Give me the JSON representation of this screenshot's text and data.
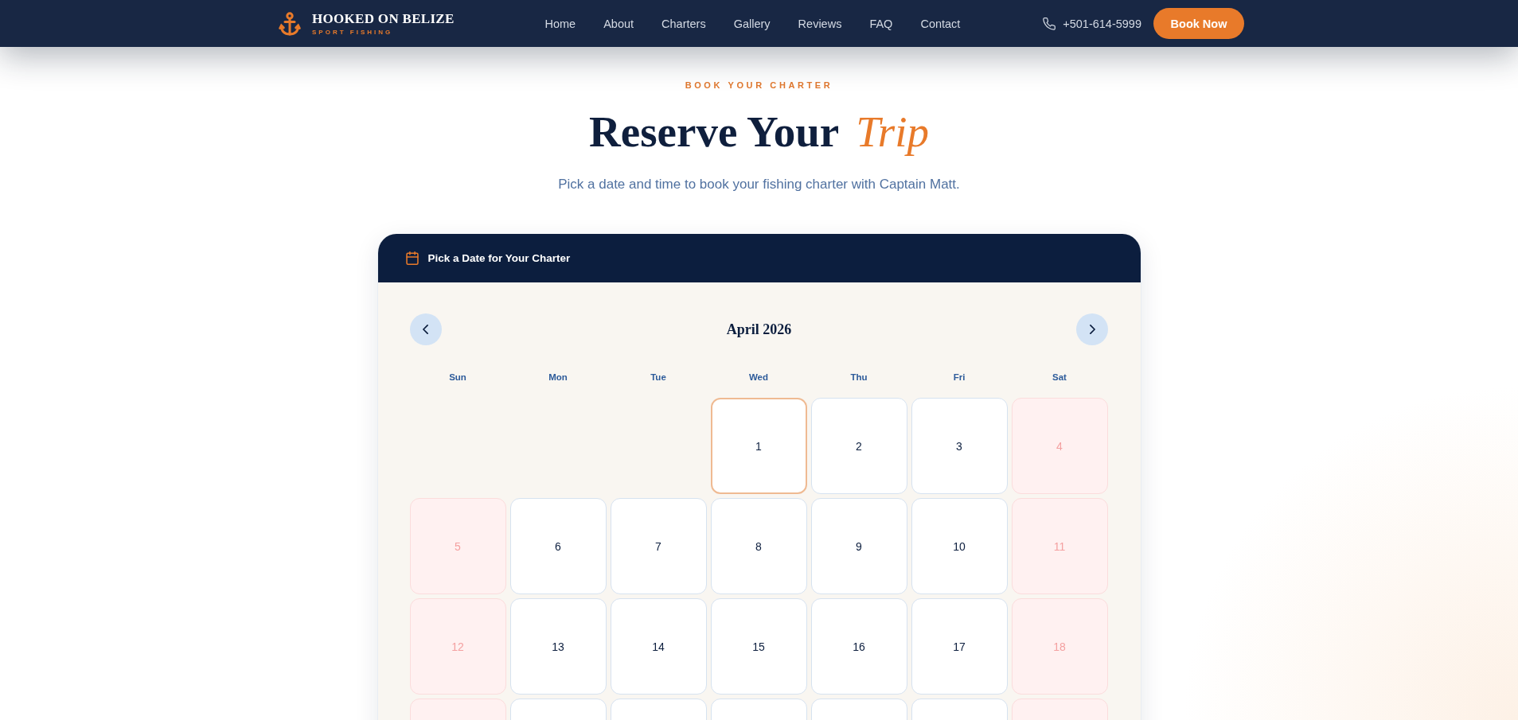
{
  "header": {
    "logo": {
      "title": "HOOKED ON BELIZE",
      "tagline": "SPORT FISHING"
    },
    "nav": [
      "Home",
      "About",
      "Charters",
      "Gallery",
      "Reviews",
      "FAQ",
      "Contact"
    ],
    "phone": "+501-614-5999",
    "cta": "Book Now"
  },
  "intro": {
    "eyebrow": "BOOK YOUR CHARTER",
    "heading": "Reserve Your *Trip*",
    "subtitle": "Pick a date and time to book your fishing charter with Captain Matt."
  },
  "calendar": {
    "title": "Pick a Date for Your Charter",
    "month": "April 2026",
    "weekdays": [
      "Sun",
      "Mon",
      "Tue",
      "Wed",
      "Thu",
      "Fri",
      "Sat"
    ],
    "weeks": [
      [
        {
          "kind": "empty"
        },
        {
          "kind": "empty"
        },
        {
          "kind": "empty"
        },
        {
          "kind": "day",
          "day": "1",
          "selected": true,
          "disabled": false
        },
        {
          "kind": "day",
          "day": "2",
          "selected": false,
          "disabled": false
        },
        {
          "kind": "day",
          "day": "3",
          "selected": false,
          "disabled": false
        },
        {
          "kind": "day",
          "day": "4",
          "selected": false,
          "disabled": true
        }
      ],
      [
        {
          "kind": "day",
          "day": "5",
          "selected": false,
          "disabled": true
        },
        {
          "kind": "day",
          "day": "6",
          "selected": false,
          "disabled": false
        },
        {
          "kind": "day",
          "day": "7",
          "selected": false,
          "disabled": false
        },
        {
          "kind": "day",
          "day": "8",
          "selected": false,
          "disabled": false
        },
        {
          "kind": "day",
          "day": "9",
          "selected": false,
          "disabled": false
        },
        {
          "kind": "day",
          "day": "10",
          "selected": false,
          "disabled": false
        },
        {
          "kind": "day",
          "day": "11",
          "selected": false,
          "disabled": true
        }
      ],
      [
        {
          "kind": "day",
          "day": "12",
          "selected": false,
          "disabled": true
        },
        {
          "kind": "day",
          "day": "13",
          "selected": false,
          "disabled": false
        },
        {
          "kind": "day",
          "day": "14",
          "selected": false,
          "disabled": false
        },
        {
          "kind": "day",
          "day": "15",
          "selected": false,
          "disabled": false
        },
        {
          "kind": "day",
          "day": "16",
          "selected": false,
          "disabled": false
        },
        {
          "kind": "day",
          "day": "17",
          "selected": false,
          "disabled": false
        },
        {
          "kind": "day",
          "day": "18",
          "selected": false,
          "disabled": true
        }
      ],
      [
        {
          "kind": "day",
          "selected": false,
          "disabled": true
        },
        {
          "kind": "day",
          "selected": false,
          "disabled": false
        },
        {
          "kind": "day",
          "selected": false,
          "disabled": false
        },
        {
          "kind": "day",
          "selected": false,
          "disabled": false
        },
        {
          "kind": "day",
          "selected": false,
          "disabled": false
        },
        {
          "kind": "day",
          "selected": false,
          "disabled": false
        },
        {
          "kind": "day",
          "selected": false,
          "disabled": true
        }
      ]
    ]
  }
}
